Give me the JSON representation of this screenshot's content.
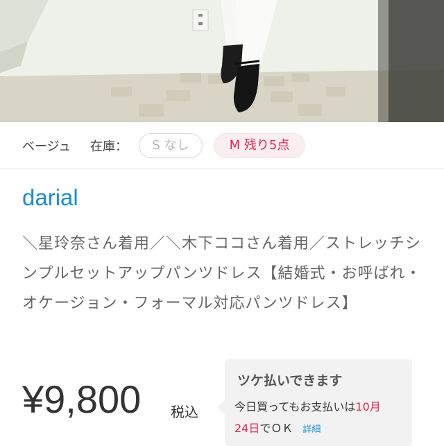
{
  "product": {
    "color": "ベージュ",
    "stock_label": "在庫：",
    "sizes": [
      {
        "label": "S なし",
        "available": false
      },
      {
        "label": "M 残り5点",
        "available": true
      }
    ],
    "brand": "darial",
    "title": "＼星玲奈さん着用／＼木下ココさん着用／ストレッチシンプルセットアップパンツドレス【結婚式・お呼ばれ・オケージョン・フォーマル対応パンツドレス】",
    "price": "¥9,800",
    "tax_label": "税込"
  },
  "pay_later": {
    "title": "ツケ払いできます",
    "line1_prefix": "今日買ってもお支払いは",
    "line1_highlight": "10月",
    "line2_highlight": "24日",
    "line2_suffix": "でＯＫ",
    "detail_link": "詳細"
  },
  "colors": {
    "brand": "#1a8ed1",
    "highlight": "#e6264f",
    "chip_selected_bg": "#fbeef1"
  }
}
